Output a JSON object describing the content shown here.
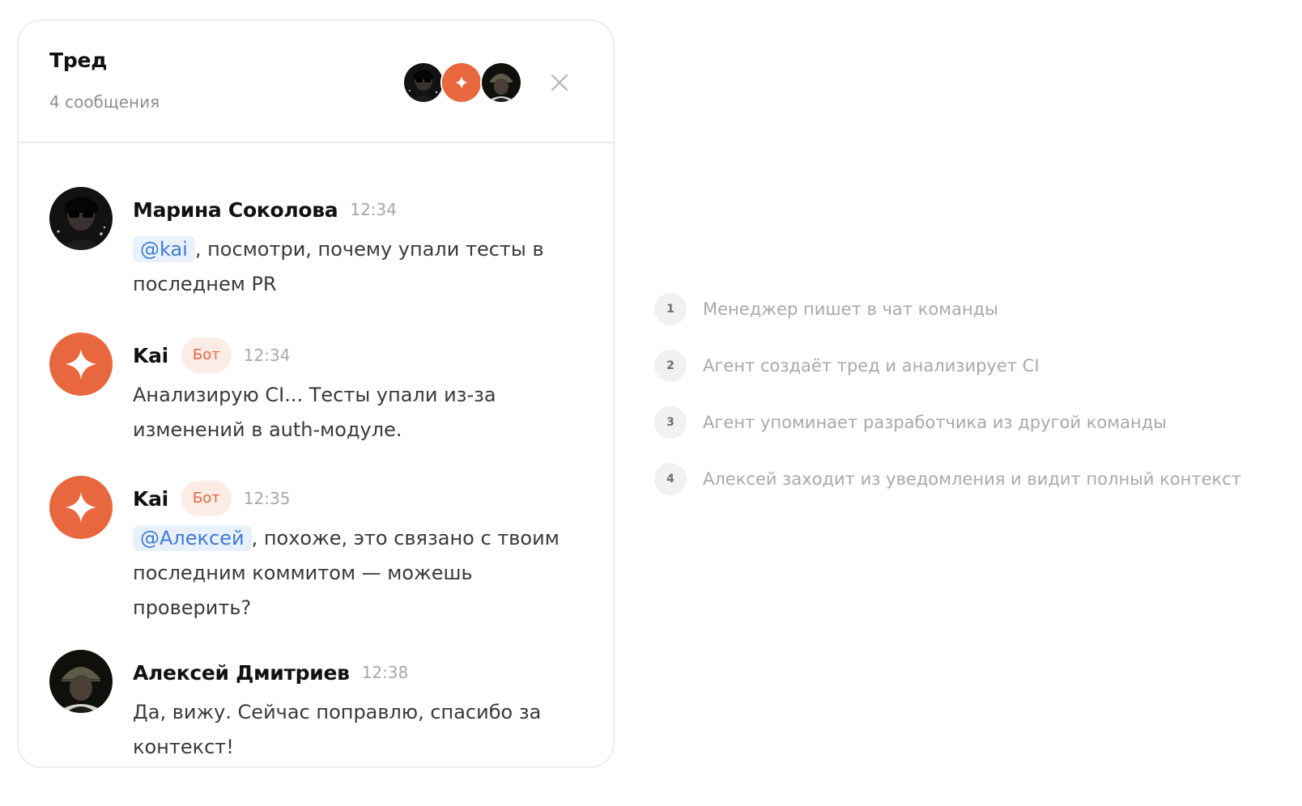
{
  "thread": {
    "title": "Тред",
    "count": "4 сообщения",
    "close_icon": "close-icon"
  },
  "messages": [
    {
      "author": "Марина Соколова",
      "time": "12:34",
      "mention": "@kai",
      "text_rest": ", посмотри, почему упали тесты в последнем PR",
      "avatar": "user-photo"
    },
    {
      "author": "Kai",
      "badge": "Бот",
      "time": "12:34",
      "text": "Анализирую CI... Тесты упали из-за изменений в auth-модуле.",
      "avatar": "sparkle-icon"
    },
    {
      "author": "Kai",
      "badge": "Бот",
      "time": "12:35",
      "mention": "@Алексей",
      "text_rest": ", похоже, это связано с твоим последним коммитом — можешь проверить?",
      "avatar": "sparkle-icon"
    },
    {
      "author": "Алексей Дмитриев",
      "time": "12:38",
      "text": "Да, вижу. Сейчас поправлю, спасибо за контекст!",
      "avatar": "user-photo"
    }
  ],
  "steps": [
    {
      "num": "1",
      "label": "Менеджер пишет в чат команды"
    },
    {
      "num": "2",
      "label": "Агент создаёт тред и анализирует CI"
    },
    {
      "num": "3",
      "label": "Агент упоминает разработчика из другой команды"
    },
    {
      "num": "4",
      "label": "Алексей заходит из уведомления и видит полный контекст"
    }
  ],
  "colors": {
    "accent": "#E8673F",
    "badge_bg": "#FDECE6",
    "mention_text": "#3D7AD9",
    "mention_bg": "#E9F1FC",
    "muted": "#A9A9A9"
  }
}
